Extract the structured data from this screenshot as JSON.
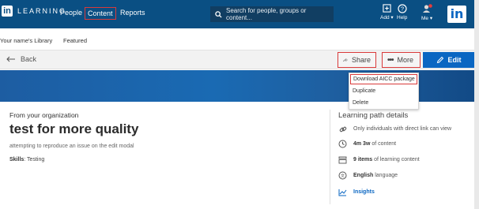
{
  "nav": {
    "logo_mark": "in",
    "logo_text": "LEARNING",
    "items": [
      {
        "label": "People"
      },
      {
        "label": "Content"
      },
      {
        "label": "Reports"
      }
    ],
    "search_placeholder": "Search for people, groups or content...",
    "add_label": "Add ▾",
    "help_label": "Help",
    "me_label": "Me ▾",
    "brand_badge": "in",
    "brand_color": "#0a4f83"
  },
  "library": {
    "my_library": "Your name's Library",
    "featured": "Featured"
  },
  "actions": {
    "back": "Back",
    "share": "Share",
    "more": "More",
    "edit": "Edit"
  },
  "more_menu": [
    {
      "label": "Download AICC package"
    },
    {
      "label": "Duplicate"
    },
    {
      "label": "Delete"
    }
  ],
  "content": {
    "org": "From your organization",
    "title": "test for more quality",
    "description": "attempting to reproduce an issue on the edit modal",
    "skills_label": "Skills",
    "skills_value": ": Testing"
  },
  "details": {
    "heading": "Learning path details",
    "access": "Only individuals with direct link can view",
    "duration_bold": "4m 3w",
    "duration_rest": " of content",
    "items_bold": "9 items",
    "items_rest": " of learning content",
    "language_bold": "English",
    "language_rest": " language",
    "insights": "Insights"
  }
}
